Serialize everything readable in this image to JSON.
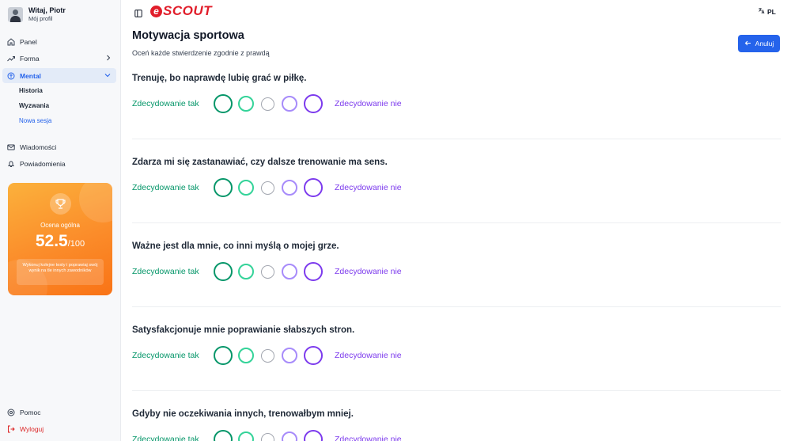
{
  "user": {
    "name": "Witaj, Piotr",
    "subtitle": "Mój profil"
  },
  "sidebar": {
    "items": [
      {
        "label": "Panel",
        "icon": "home-icon"
      },
      {
        "label": "Forma",
        "icon": "trending-up-icon"
      },
      {
        "label": "Mental",
        "icon": "brain-icon",
        "active": true
      },
      {
        "label": "Wiadomości",
        "icon": "mail-icon"
      },
      {
        "label": "Powiadomienia",
        "icon": "bell-icon"
      }
    ],
    "subitems": [
      {
        "label": "Historia"
      },
      {
        "label": "Wyzwania"
      },
      {
        "label": "Nowa sesja",
        "active": true
      }
    ],
    "bottom": [
      {
        "label": "Pomoc",
        "icon": "help-circle-icon"
      },
      {
        "label": "Wyloguj",
        "icon": "logout-icon"
      }
    ]
  },
  "score": {
    "label": "Ocena ogólna",
    "value": "52.5",
    "max": "/100",
    "note": "Wykonuj kolejne testy i poprawiaj swój wynik na tle innych zawodników"
  },
  "header": {
    "brand": "SCOUT",
    "brand_letter": "e",
    "lang": "PL"
  },
  "page": {
    "title": "Motywacja sportowa",
    "subtitle": "Oceń każde stwierdzenie zgodnie z prawdą",
    "cancel": "Anuluj"
  },
  "scale": {
    "agree": "Zdecydowanie tak",
    "disagree": "Zdecydowanie nie"
  },
  "questions": [
    {
      "text": "Trenuję, bo naprawdę lubię grać w piłkę."
    },
    {
      "text": "Zdarza mi się zastanawiać, czy dalsze trenowanie ma sens."
    },
    {
      "text": "Ważne jest dla mnie, co inni myślą o mojej grze."
    },
    {
      "text": "Satysfakcjonuje mnie poprawianie słabszych stron."
    },
    {
      "text": "Gdyby nie oczekiwania innych, trenowałbym mniej."
    }
  ],
  "colors": {
    "accent": "#2563eb",
    "brand": "#e11d2a",
    "agree": "#059669",
    "disagree": "#7c3aed",
    "logout": "#dc2626"
  }
}
